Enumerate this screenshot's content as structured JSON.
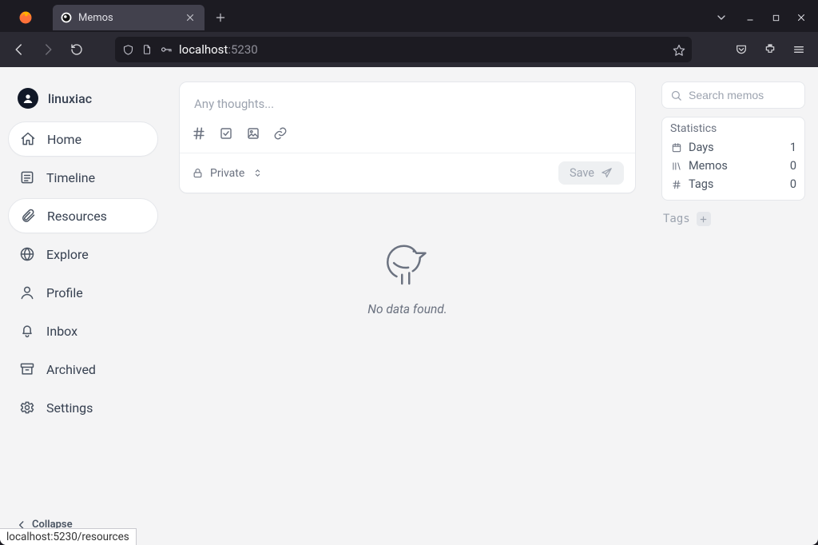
{
  "browser": {
    "tab_title": "Memos",
    "url_host": "localhost",
    "url_port": ":5230"
  },
  "sidebar": {
    "username": "linuxiac",
    "items": [
      {
        "label": "Home"
      },
      {
        "label": "Timeline"
      },
      {
        "label": "Resources"
      },
      {
        "label": "Explore"
      },
      {
        "label": "Profile"
      },
      {
        "label": "Inbox"
      },
      {
        "label": "Archived"
      },
      {
        "label": "Settings"
      }
    ],
    "collapse_label": "Collapse"
  },
  "composer": {
    "placeholder": "Any thoughts...",
    "visibility_label": "Private",
    "save_label": "Save"
  },
  "main": {
    "empty_message": "No data found."
  },
  "right": {
    "search_placeholder": "Search memos",
    "stats_title": "Statistics",
    "stats": [
      {
        "label": "Days",
        "value": "1"
      },
      {
        "label": "Memos",
        "value": "0"
      },
      {
        "label": "Tags",
        "value": "0"
      }
    ],
    "tags_label": "Tags"
  },
  "status_tip": "localhost:5230/resources"
}
